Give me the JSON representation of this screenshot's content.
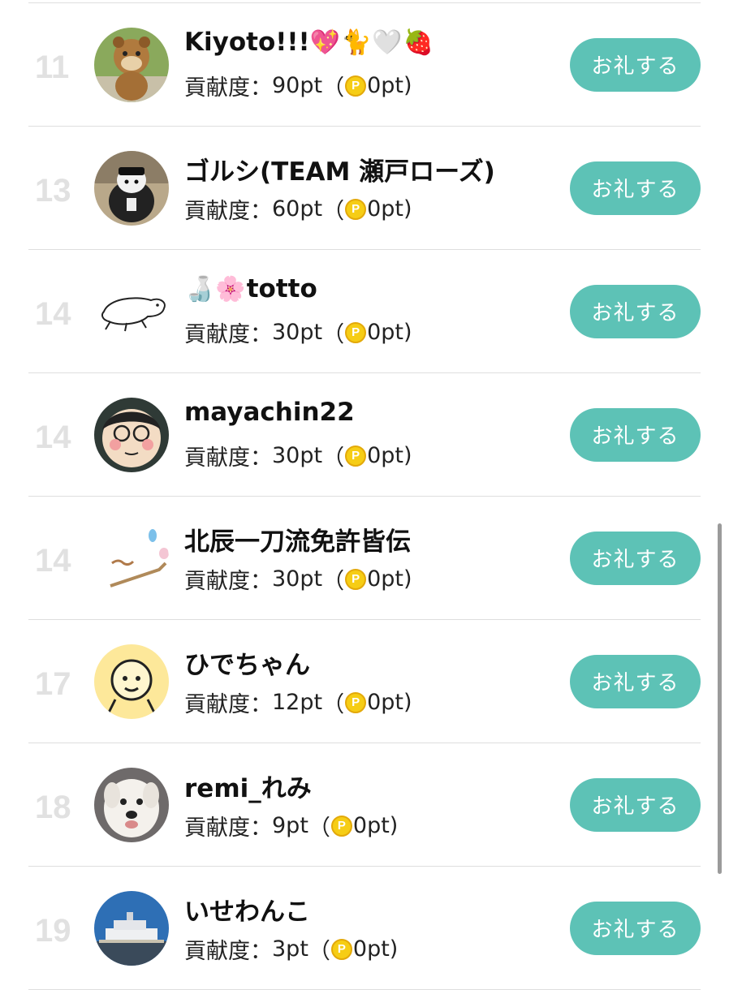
{
  "button_label": "お礼する",
  "contribution_label": "貢献度：",
  "coin_glyph": "P",
  "colors": {
    "button": "#5dc2b6",
    "rank": "#e1e1e1",
    "coin": "#f6cd15"
  },
  "rows": [
    {
      "rank": "11",
      "name": "Kiyoto!!!",
      "emoji": "💖🐈🤍🍓",
      "points": "90pt",
      "paren_open": "（",
      "coin_points": "0pt)",
      "avatar_icon": "lion-mascot-avatar"
    },
    {
      "rank": "13",
      "name": "ゴルシ(TEAM 瀬戸ローズ)",
      "emoji": "",
      "points": "60pt",
      "paren_open": "（",
      "coin_points": "0pt)",
      "avatar_icon": "horse-plush-avatar"
    },
    {
      "rank": "14",
      "name": "totto",
      "emoji_prefix": "🍶🌸",
      "points": "30pt",
      "paren_open": "（",
      "coin_points": "0pt)",
      "avatar_icon": "sketch-animal-avatar"
    },
    {
      "rank": "14",
      "name": "mayachin22",
      "emoji": "",
      "points": "30pt",
      "paren_open": "（",
      "coin_points": "0pt)",
      "avatar_icon": "glasses-face-avatar"
    },
    {
      "rank": "14",
      "name": "北辰一刀流免許皆伝",
      "emoji": "",
      "points": "30pt",
      "paren_open": "（",
      "coin_points": "0pt)",
      "avatar_icon": "sketch-brush-avatar"
    },
    {
      "rank": "17",
      "name": "ひでちゃん",
      "emoji": "",
      "points": "12pt",
      "paren_open": "（",
      "coin_points": "0pt)",
      "avatar_icon": "smiley-face-avatar"
    },
    {
      "rank": "18",
      "name": "remi_れみ",
      "emoji": "",
      "points": "9pt",
      "paren_open": "（",
      "coin_points": "0pt)",
      "avatar_icon": "dog-photo-avatar"
    },
    {
      "rank": "19",
      "name": "いせわんこ",
      "emoji": "",
      "points": "3pt",
      "paren_open": "（",
      "coin_points": "0pt)",
      "avatar_icon": "ship-photo-avatar"
    }
  ]
}
